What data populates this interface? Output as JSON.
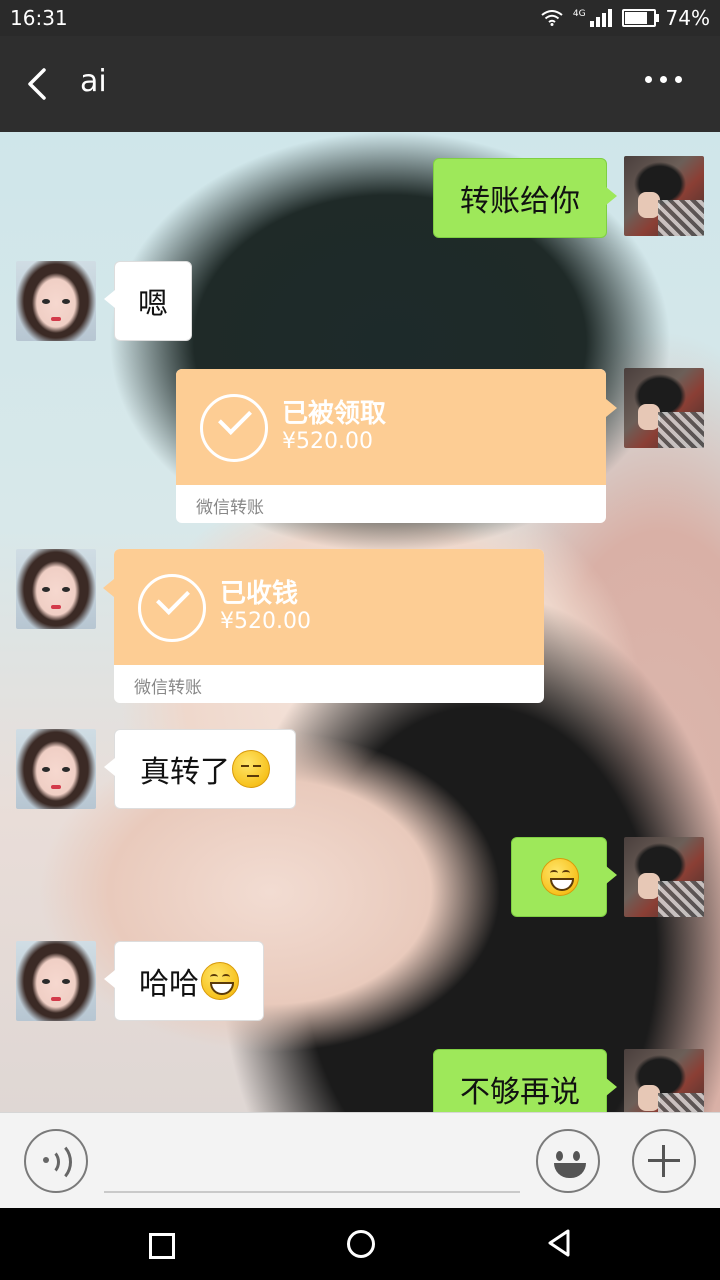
{
  "status_bar": {
    "time": "16:31",
    "network": "4G",
    "battery": "74%"
  },
  "header": {
    "title": "ai",
    "back_icon": "chevron-left-icon",
    "more_icon": "more-dots-icon"
  },
  "messages": [
    {
      "side": "right",
      "type": "text",
      "text": "转账给你"
    },
    {
      "side": "left",
      "type": "text",
      "text": "嗯"
    },
    {
      "side": "right",
      "type": "transfer",
      "status": "已被领取",
      "amount": "¥520.00",
      "footer": "微信转账"
    },
    {
      "side": "left",
      "type": "transfer",
      "status": "已收钱",
      "amount": "¥520.00",
      "footer": "微信转账"
    },
    {
      "side": "left",
      "type": "text",
      "text": "真转了",
      "emoji": "unamused-face"
    },
    {
      "side": "right",
      "type": "emoji",
      "emoji": "grinning-face"
    },
    {
      "side": "left",
      "type": "text",
      "text": "哈哈",
      "emoji": "grinning-face"
    },
    {
      "side": "right",
      "type": "text",
      "text": "不够再说"
    }
  ],
  "input_bar": {
    "voice_icon": "voice-icon",
    "emoji_icon": "emoji-icon",
    "add_icon": "plus-icon",
    "value": ""
  },
  "nav": {
    "recents_icon": "square-icon",
    "home_icon": "circle-icon",
    "back_icon": "triangle-back-icon"
  },
  "colors": {
    "sent_bubble": "#9ee85a",
    "received_bubble": "#ffffff",
    "transfer": "#fdcd94"
  }
}
